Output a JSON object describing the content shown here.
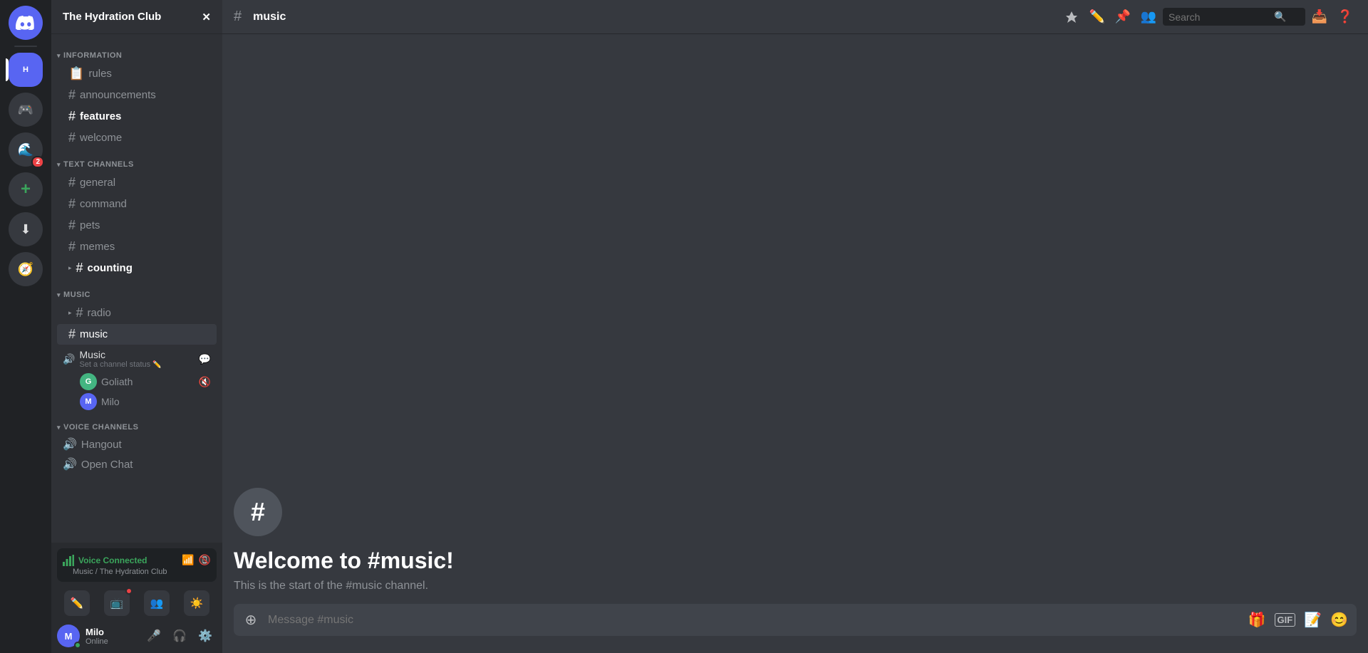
{
  "server": {
    "name": "The Hydration Club",
    "dropdown_icon": "▼"
  },
  "sidebar": {
    "categories": [
      {
        "id": "information",
        "label": "INFORMATION",
        "channels": [
          {
            "id": "rules",
            "name": "rules",
            "type": "text",
            "icon": "📋"
          },
          {
            "id": "announcements",
            "name": "announcements",
            "type": "text"
          },
          {
            "id": "features",
            "name": "features",
            "type": "text",
            "bold": true
          },
          {
            "id": "welcome",
            "name": "welcome",
            "type": "text"
          }
        ]
      },
      {
        "id": "text-channels",
        "label": "TEXT CHANNELS",
        "channels": [
          {
            "id": "general",
            "name": "general",
            "type": "text"
          },
          {
            "id": "command",
            "name": "command",
            "type": "text"
          },
          {
            "id": "pets",
            "name": "pets",
            "type": "text"
          },
          {
            "id": "memes",
            "name": "memes",
            "type": "text"
          },
          {
            "id": "counting",
            "name": "counting",
            "type": "text",
            "bold": true
          }
        ]
      },
      {
        "id": "music",
        "label": "MUSIC",
        "channels": [
          {
            "id": "radio",
            "name": "radio",
            "type": "text"
          },
          {
            "id": "music",
            "name": "music",
            "type": "text",
            "active": true
          }
        ]
      },
      {
        "id": "voice-channels",
        "label": "VOICE CHANNELS",
        "channels": [
          {
            "id": "hangout",
            "name": "Hangout",
            "type": "voice"
          },
          {
            "id": "open-chat",
            "name": "Open Chat",
            "type": "voice"
          }
        ]
      }
    ],
    "music_voice": {
      "name": "Music",
      "set_status": "Set a channel status",
      "edit_icon": "✏️",
      "members": [
        {
          "id": "goliath",
          "name": "Goliath",
          "color": "#43b581",
          "initial": "G",
          "icon": "🔇"
        },
        {
          "id": "milo",
          "name": "Milo",
          "color": "#5865f2",
          "initial": "M"
        }
      ]
    }
  },
  "user_panel": {
    "voice_connected": {
      "label": "Voice Connected",
      "channel_path": "Music / The Hydration Club"
    },
    "user": {
      "name": "Milo",
      "status": "Online",
      "initial": "M",
      "color": "#5865f2"
    },
    "voice_actions": [
      {
        "id": "pencil",
        "icon": "✏️",
        "label": "Edit"
      },
      {
        "id": "camera",
        "icon": "📺",
        "label": "Camera",
        "has_badge": true
      },
      {
        "id": "people",
        "icon": "👥",
        "label": "People"
      },
      {
        "id": "sun",
        "icon": "☀️",
        "label": "Activities"
      }
    ],
    "user_actions": [
      {
        "id": "mute",
        "icon": "🎤",
        "label": "Mute"
      },
      {
        "id": "deafen",
        "icon": "🎧",
        "label": "Deafen"
      },
      {
        "id": "settings",
        "icon": "⚙️",
        "label": "Settings"
      }
    ]
  },
  "top_bar": {
    "channel_name": "music",
    "actions": [
      {
        "id": "boost",
        "icon": "🚀",
        "label": "Boost"
      },
      {
        "id": "edit",
        "icon": "✏️",
        "label": "Edit"
      },
      {
        "id": "pin",
        "icon": "📌",
        "label": "Pins"
      },
      {
        "id": "members",
        "icon": "👥",
        "label": "Members"
      }
    ],
    "search": {
      "placeholder": "Search",
      "icon": "🔍"
    },
    "right_actions": [
      {
        "id": "inbox",
        "icon": "📥",
        "label": "Inbox"
      },
      {
        "id": "help",
        "icon": "❓",
        "label": "Help"
      }
    ]
  },
  "chat": {
    "welcome_title": "Welcome to #music!",
    "welcome_description": "This is the start of the #music channel.",
    "message_placeholder": "Message #music"
  }
}
